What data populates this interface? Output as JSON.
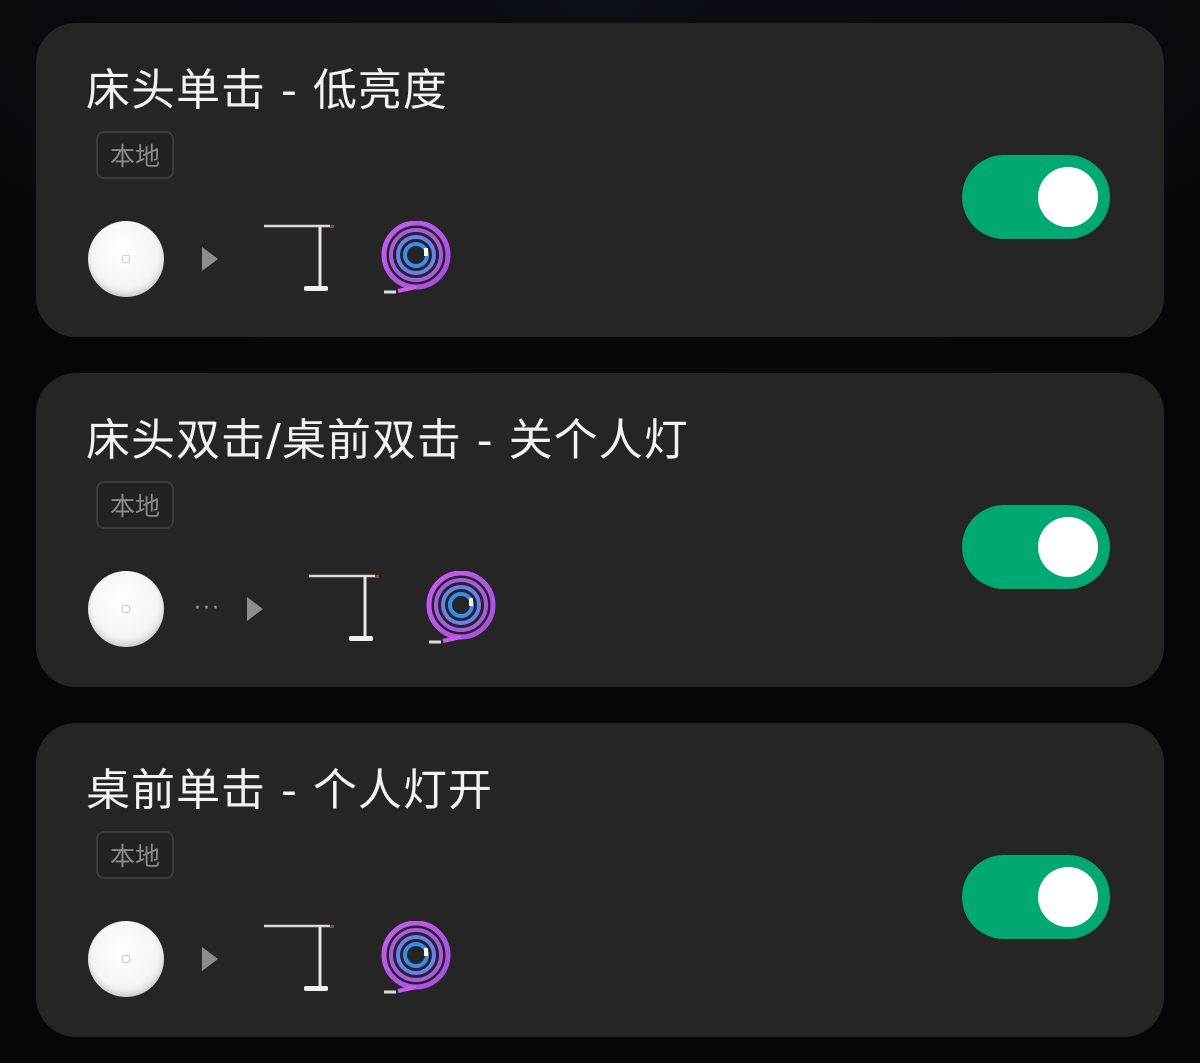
{
  "automations": [
    {
      "title": "床头单击 - 低亮度",
      "badge": "本地",
      "enabled": true,
      "show_ellipsis": false,
      "trigger_device_icon": "round-wireless-switch",
      "action_icons": [
        "desk-lamp-icon",
        "light-strip-icon"
      ]
    },
    {
      "title": "床头双击/桌前双击 - 关个人灯",
      "badge": "本地",
      "enabled": true,
      "show_ellipsis": true,
      "ellipsis": "···",
      "trigger_device_icon": "round-wireless-switch",
      "action_icons": [
        "desk-lamp-icon",
        "light-strip-icon"
      ]
    },
    {
      "title": "桌前单击 - 个人灯开",
      "badge": "本地",
      "enabled": true,
      "show_ellipsis": false,
      "trigger_device_icon": "round-wireless-switch",
      "action_icons": [
        "desk-lamp-icon",
        "light-strip-icon"
      ]
    }
  ],
  "colors": {
    "card_background": "#252526",
    "toggle_on": "#00a874",
    "page_background": "#06080c"
  }
}
